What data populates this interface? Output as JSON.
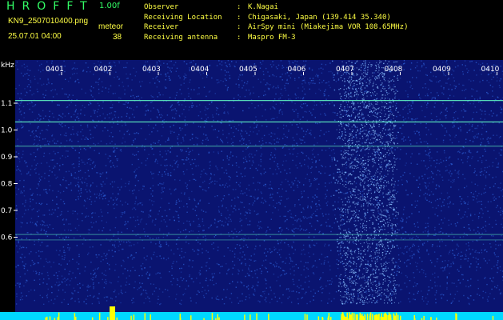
{
  "header": {
    "app_title": "HROFFT",
    "version": "1.00f",
    "filename": "KN9_2507010400.png",
    "timestamp": "25.07.01 04:00",
    "meteor_label": "meteor",
    "meteor_count": "38"
  },
  "info": [
    {
      "key": "Observer",
      "sep": ":",
      "value": "K.Nagai"
    },
    {
      "key": "Receiving Location",
      "sep": ":",
      "value": "Chigasaki, Japan (139.414 35.340)"
    },
    {
      "key": "Receiver",
      "sep": ":",
      "value": "AirSpy mini (Miakejima VOR 108.65MHz)"
    },
    {
      "key": "Receiving antenna",
      "sep": ":",
      "value": "Maspro FM-3"
    }
  ],
  "spectrogram": {
    "y_unit": "kHz",
    "y_ticks": [
      "1.1",
      "1.0",
      "0.9",
      "0.8",
      "0.7",
      "0.6"
    ],
    "x_ticks": [
      "0401",
      "0402",
      "0403",
      "0404",
      "0405",
      "0406",
      "0407",
      "0408",
      "0409",
      "0410"
    ],
    "colors": {
      "background": "#0a1470",
      "noise": "#2a5acf",
      "carrier": "#5ef0c0",
      "bottom_band": "#00d8ff",
      "bottom_yellow": "#ffff00"
    }
  }
}
